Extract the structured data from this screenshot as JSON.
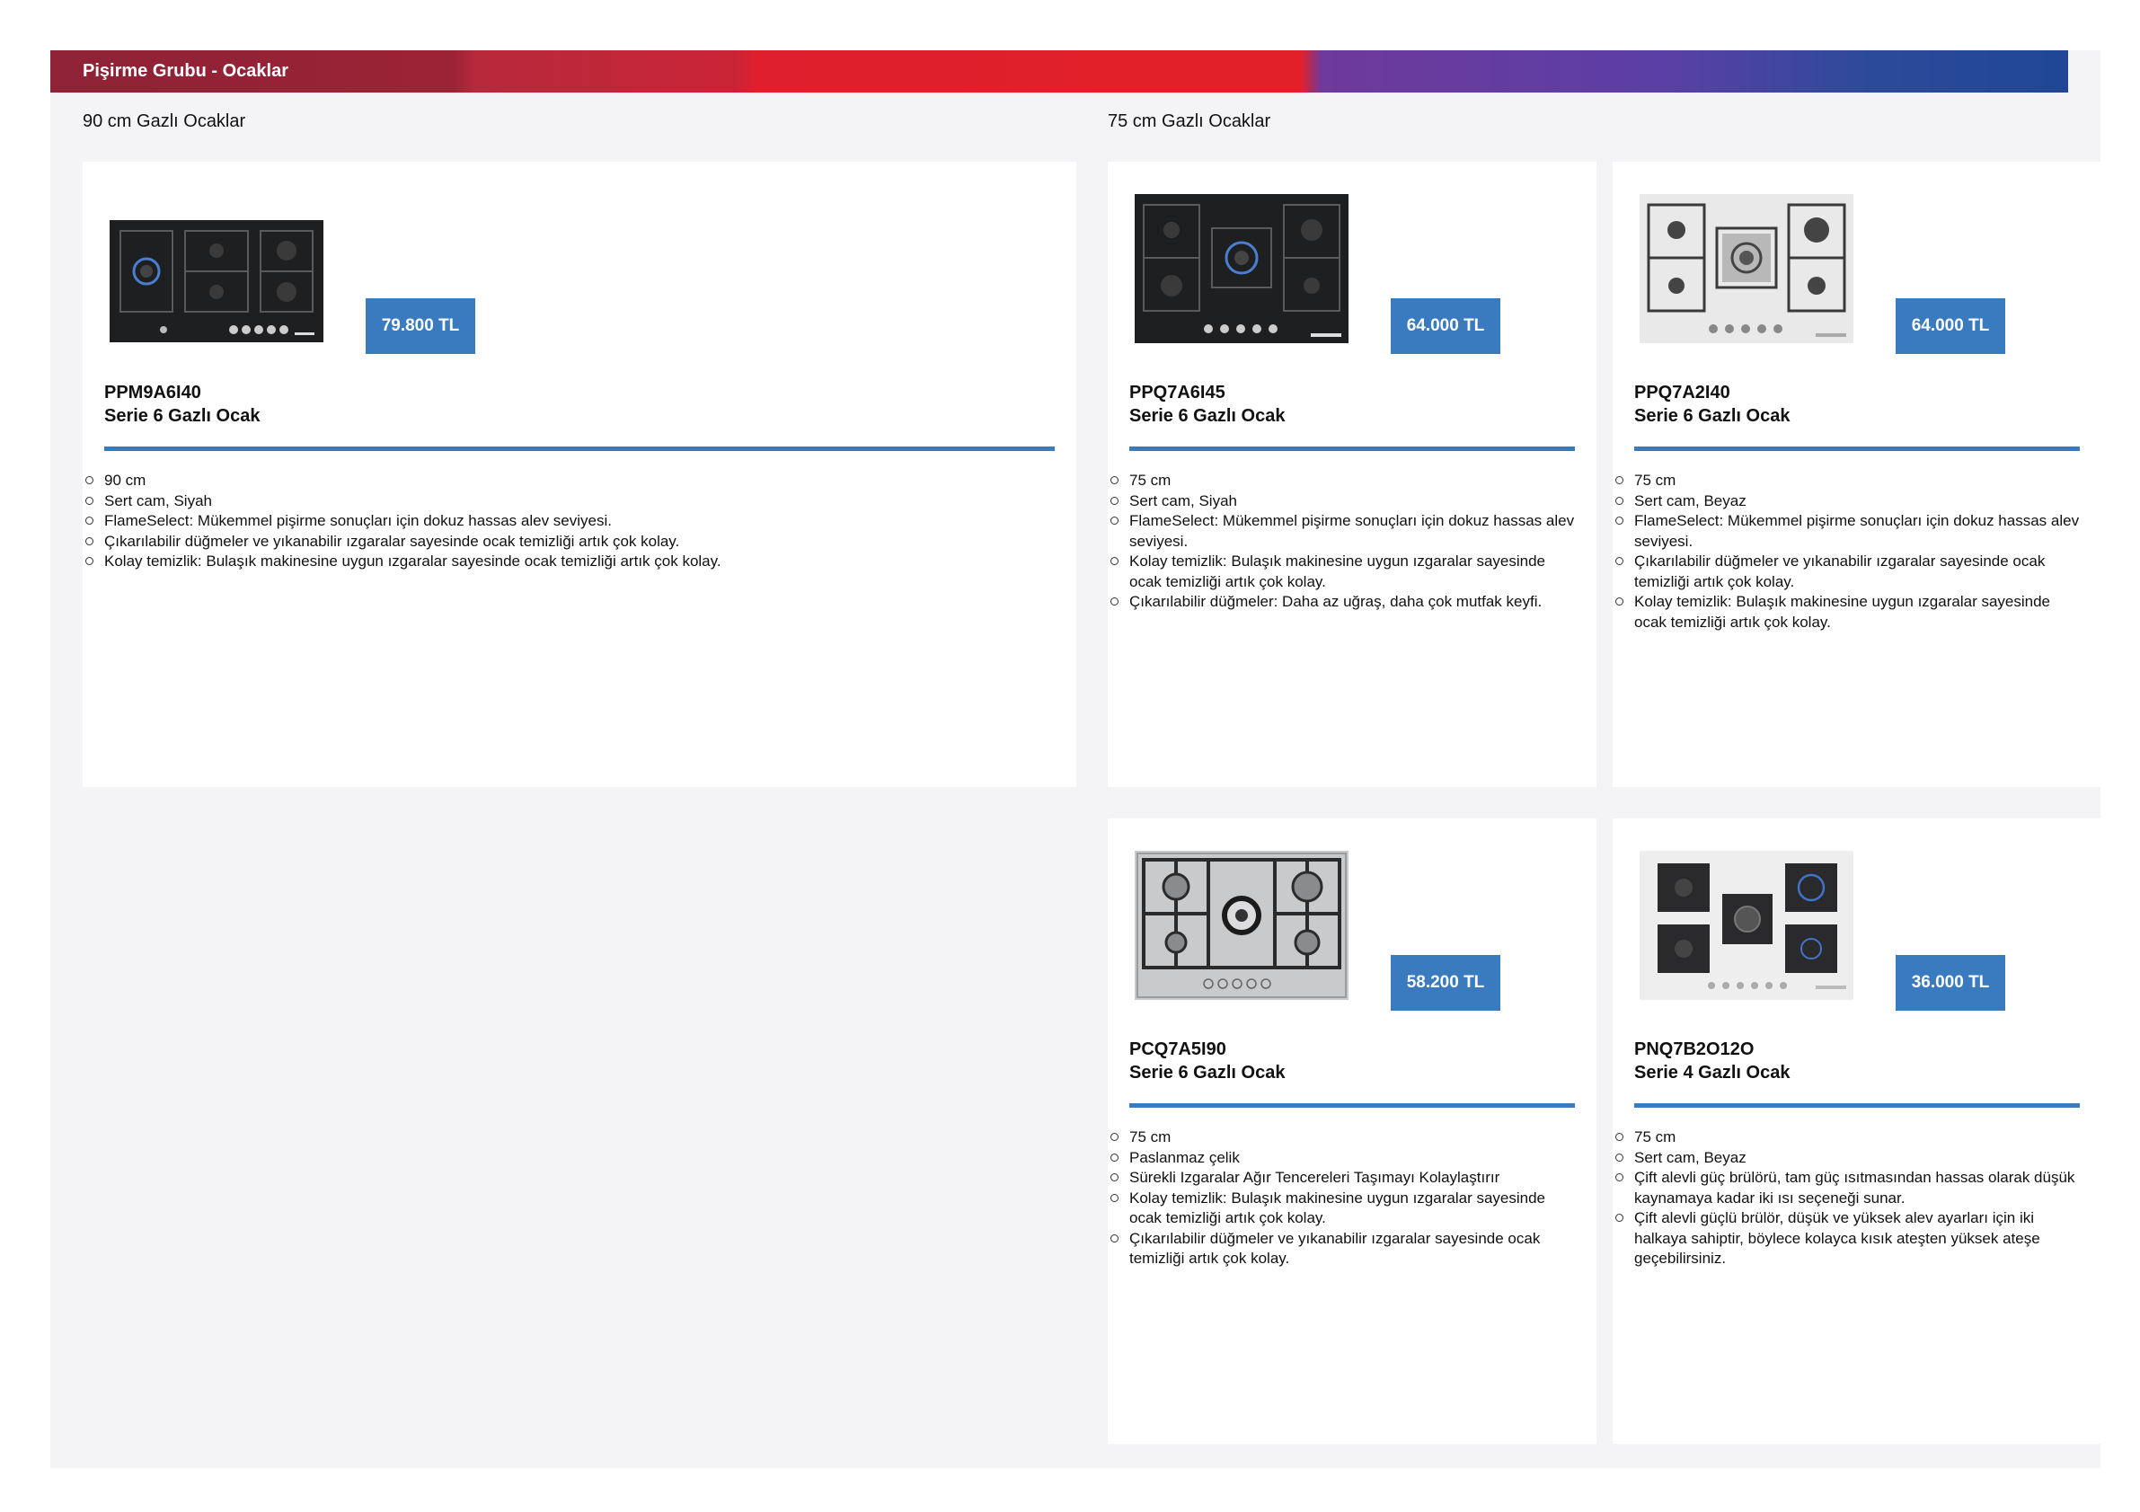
{
  "header": {
    "title": "Pişirme Grubu - Ocaklar"
  },
  "sections": {
    "s90": "90 cm Gazlı Ocaklar",
    "s75": "75 cm Gazlı Ocaklar"
  },
  "colors": {
    "accent": "#3a7abf",
    "banner_red": "#e22029",
    "banner_purple": "#6e3a9c",
    "banner_blue": "#1f4796"
  },
  "products": [
    {
      "model": "PPM9A6I40",
      "series": "Serie 6 Gazlı Ocak",
      "price": "79.800 TL",
      "image": "black-glass-5-burner-hob",
      "features": [
        "90 cm",
        "Sert cam, Siyah",
        "FlameSelect: Mükemmel pişirme sonuçları için dokuz hassas alev seviyesi.",
        "Çıkarılabilir düğmeler ve yıkanabilir ızgaralar sayesinde ocak temizliği artık çok kolay.",
        "Kolay temizlik: Bulaşık makinesine uygun ızgaralar sayesinde ocak temizliği artık çok kolay."
      ]
    },
    {
      "model": "PPQ7A6I45",
      "series": "Serie 6 Gazlı Ocak",
      "price": "64.000 TL",
      "image": "black-glass-5-burner-hob",
      "features": [
        "75 cm",
        "Sert cam, Siyah",
        "FlameSelect: Mükemmel pişirme sonuçları için dokuz hassas alev seviyesi.",
        "Kolay temizlik: Bulaşık makinesine uygun ızgaralar sayesinde ocak temizliği artık çok kolay.",
        "Çıkarılabilir düğmeler: Daha az uğraş, daha çok mutfak keyfi."
      ]
    },
    {
      "model": "PPQ7A2I40",
      "series": "Serie 6 Gazlı Ocak",
      "price": "64.000 TL",
      "image": "white-glass-5-burner-hob",
      "features": [
        "75 cm",
        "Sert cam, Beyaz",
        "FlameSelect: Mükemmel pişirme sonuçları için dokuz hassas alev seviyesi.",
        "Çıkarılabilir düğmeler ve yıkanabilir ızgaralar sayesinde ocak temizliği artık çok kolay.",
        "Kolay temizlik: Bulaşık makinesine uygun ızgaralar sayesinde ocak temizliği artık çok kolay."
      ]
    },
    {
      "model": "PCQ7A5I90",
      "series": "Serie 6 Gazlı Ocak",
      "price": "58.200 TL",
      "image": "stainless-steel-5-burner-hob",
      "features": [
        "75 cm",
        "Paslanmaz çelik",
        "Sürekli Izgaralar Ağır Tencereleri Taşımayı Kolaylaştırır",
        "Kolay temizlik: Bulaşık makinesine uygun ızgaralar sayesinde ocak temizliği artık çok kolay.",
        "Çıkarılabilir düğmeler ve yıkanabilir ızgaralar sayesinde ocak temizliği artık çok kolay."
      ]
    },
    {
      "model": "PNQ7B2O12O",
      "series": "Serie 4 Gazlı Ocak",
      "price": "36.000 TL",
      "image": "white-glass-5-burner-hob",
      "features": [
        "75 cm",
        "Sert cam, Beyaz",
        "Çift alevli güç brülörü, tam güç ısıtmasından hassas olarak düşük kaynamaya kadar iki ısı seçeneği sunar.",
        "Çift alevli güçlü brülör, düşük ve yüksek alev ayarları için iki halkaya sahiptir, böylece kolayca kısık ateşten yüksek ateşe geçebilirsiniz."
      ]
    }
  ]
}
